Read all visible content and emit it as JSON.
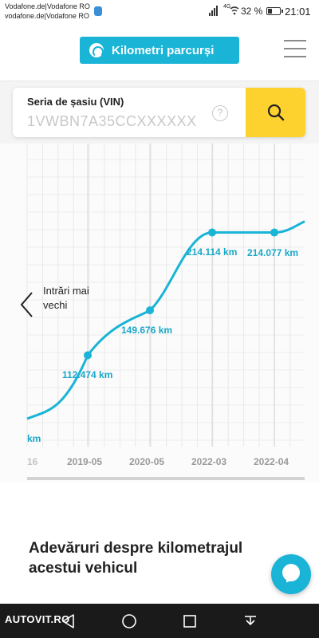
{
  "status_bar": {
    "carrier_line1": "Vodafone.de|Vodafone RO",
    "carrier_line2": "vodafone.de|Vodafone RO",
    "network": "4G",
    "battery": "32 %",
    "time": "21:01"
  },
  "header": {
    "km_button_label": "Kilometri parcurși",
    "menu_icon": "hamburger-icon"
  },
  "search": {
    "label": "Seria de șasiu (VIN)",
    "value": "1VWBN7A35CCXXXXXX",
    "help_label": "?",
    "button_icon": "search-icon"
  },
  "chart": {
    "older_entries_label": "Intrări mai vechi"
  },
  "chart_data": {
    "type": "line",
    "x": [
      "2019-05",
      "2020-05",
      "2022-03",
      "2022-04"
    ],
    "x_ticks": [
      "16",
      "2019-05",
      "2020-05",
      "2022-03",
      "2022-04"
    ],
    "y": [
      112474,
      149676,
      214114,
      214077
    ],
    "point_labels": [
      "112.474 km",
      "149.676 km",
      "214.114 km",
      "214.077 km"
    ],
    "partial_left_label": "km",
    "grid": true,
    "color": "#19b4d6"
  },
  "facts": {
    "title": "Adevăruri despre kilometrajul acestui vehicul"
  },
  "chat": {
    "icon": "chat-bubble-icon"
  },
  "navbar": {
    "watermark": "AUTOVIT.RO"
  }
}
